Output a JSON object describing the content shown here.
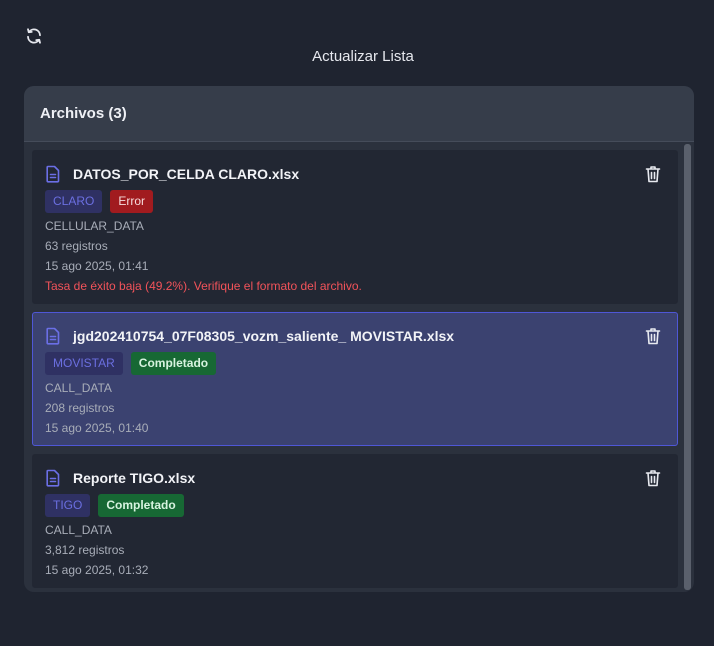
{
  "toolbar": {
    "refresh_icon": "refresh-icon",
    "refresh_label": "Actualizar Lista"
  },
  "panel": {
    "title": "Archivos (3)"
  },
  "files": [
    {
      "name": "DATOS_POR_CELDA CLARO.xlsx",
      "operator": "CLARO",
      "status": "Error",
      "type": "CELLULAR_DATA",
      "records": "63 registros",
      "date": "15 ago 2025, 01:41",
      "message": "Tasa de éxito baja (49.2%). Verifique el formato del archivo.",
      "selected": false
    },
    {
      "name": "jgd202410754_07F08305_vozm_saliente_ MOVISTAR.xlsx",
      "operator": "MOVISTAR",
      "status": "Completado",
      "type": "CALL_DATA",
      "records": "208 registros",
      "date": "15 ago 2025, 01:40",
      "selected": true
    },
    {
      "name": "Reporte TIGO.xlsx",
      "operator": "TIGO",
      "status": "Completado",
      "type": "CALL_DATA",
      "records": "3,812 registros",
      "date": "15 ago 2025, 01:32",
      "selected": false
    }
  ],
  "colors": {
    "background": "#1f2430",
    "card": "#222733",
    "selected_card": "#3b4270",
    "selected_border": "#4f57d6",
    "error": "#a11b1f",
    "success": "#176834",
    "error_text": "#f2535a",
    "operator_badge_text": "#6b6fe0"
  }
}
